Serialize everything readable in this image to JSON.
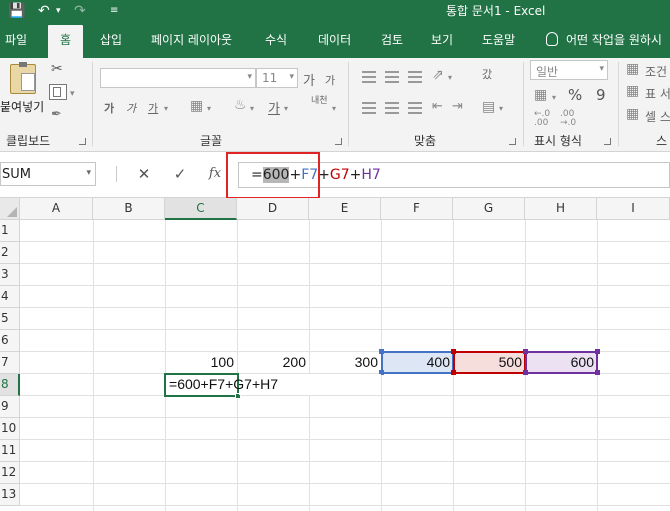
{
  "app": {
    "title": "통합 문서1  -  Excel",
    "accent": "#217346"
  },
  "tabs": [
    {
      "label": "파일"
    },
    {
      "label": "홈"
    },
    {
      "label": "삽입"
    },
    {
      "label": "페이지 레이아웃"
    },
    {
      "label": "수식"
    },
    {
      "label": "데이터"
    },
    {
      "label": "검토"
    },
    {
      "label": "보기"
    },
    {
      "label": "도움말"
    },
    {
      "label": "어떤 작업을 원하시"
    }
  ],
  "ribbon": {
    "clipboard": {
      "paste": "붙여넣기",
      "label": "클립보드"
    },
    "font": {
      "size": "11",
      "label": "글꼴",
      "bold": "가",
      "italic": "가",
      "underline": "가",
      "grow": "가",
      "shrink": "가",
      "phonetic": "내천"
    },
    "alignment": {
      "label": "맞춤",
      "wrap": "갔"
    },
    "number": {
      "format": "일반",
      "label": "표시 형식",
      "pct": "%",
      "comma": "9"
    },
    "styles": {
      "conditional": "조건",
      "table": "표 서",
      "cell": "셀 스",
      "label": "스"
    }
  },
  "formula_bar": {
    "name_box": "SUM",
    "fx": "fx",
    "formula": {
      "eq": "=",
      "p1": "600",
      "plus1": "+",
      "p2": "F7",
      "plus2": "+",
      "p3": "G7",
      "plus3": "+",
      "p4": "H7"
    }
  },
  "grid": {
    "columns": [
      "A",
      "B",
      "C",
      "D",
      "E",
      "F",
      "G",
      "H",
      "I"
    ],
    "rows": [
      "1",
      "2",
      "3",
      "4",
      "5",
      "6",
      "7",
      "8",
      "9",
      "10",
      "11",
      "12",
      "13"
    ],
    "cells": {
      "C7": "100",
      "D7": "200",
      "E7": "300",
      "F7": "400",
      "G7": "500",
      "H7": "600"
    },
    "editing": {
      "eq": "=",
      "p1": "600",
      "plus1": "+",
      "p2": "F7",
      "plus2": "+",
      "p3": "G7",
      "plus3": "+",
      "p4": "H7"
    }
  },
  "colors": {
    "ref_blue": "#4472c4",
    "ref_red": "#c00000",
    "ref_purple": "#7030a0",
    "highlight_box": "#e02424"
  }
}
